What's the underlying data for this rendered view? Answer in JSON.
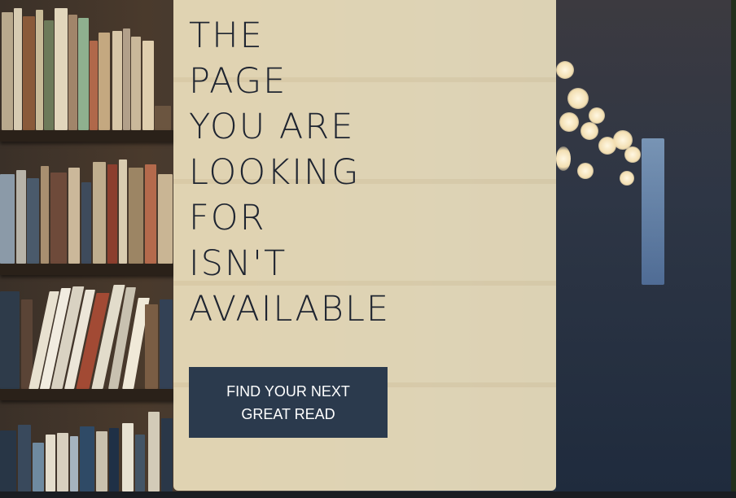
{
  "error_page": {
    "headline_lines": [
      "THE",
      "PAGE",
      "YOU ARE",
      "LOOKING",
      "FOR",
      "ISN'T",
      "AVAILABLE"
    ],
    "cta_label": "FIND YOUR NEXT GREAT READ"
  },
  "colors": {
    "panel_background": "#f6e8c4",
    "headline_text": "#1e2430",
    "cta_background": "#2b3a4d",
    "cta_text": "#ffffff"
  }
}
